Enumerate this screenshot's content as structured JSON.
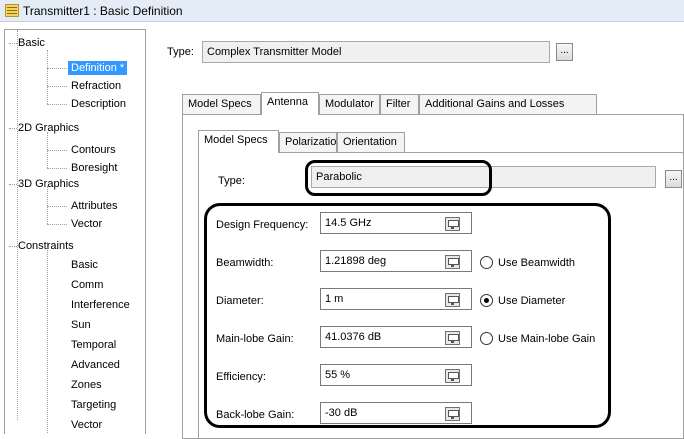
{
  "window": {
    "title": "Transmitter1 : Basic Definition",
    "icon": "document-icon"
  },
  "tree": {
    "items": [
      {
        "label": "Basic",
        "level": 0
      },
      {
        "label": "Definition *",
        "level": 1,
        "selected": true
      },
      {
        "label": "Refraction",
        "level": 1
      },
      {
        "label": "Description",
        "level": 1
      },
      {
        "label": "2D Graphics",
        "level": 0
      },
      {
        "label": "Contours",
        "level": 1
      },
      {
        "label": "Boresight",
        "level": 1
      },
      {
        "label": "3D Graphics",
        "level": 0
      },
      {
        "label": "Attributes",
        "level": 1
      },
      {
        "label": "Vector",
        "level": 1
      },
      {
        "label": "Constraints",
        "level": 0
      },
      {
        "label": "Basic",
        "level": 1
      },
      {
        "label": "Comm",
        "level": 1
      },
      {
        "label": "Interference",
        "level": 1
      },
      {
        "label": "Sun",
        "level": 1
      },
      {
        "label": "Temporal",
        "level": 1
      },
      {
        "label": "Advanced",
        "level": 1
      },
      {
        "label": "Zones",
        "level": 1
      },
      {
        "label": "Targeting",
        "level": 1
      },
      {
        "label": "Vector",
        "level": 1
      }
    ]
  },
  "type_row": {
    "label": "Type:",
    "value": "Complex Transmitter Model",
    "button": "..."
  },
  "outer_tabs": [
    "Model Specs",
    "Antenna",
    "Modulator",
    "Filter",
    "Additional Gains and Losses"
  ],
  "outer_active_tab": "Antenna",
  "inner_tabs": [
    "Model Specs",
    "Polarization",
    "Orientation"
  ],
  "inner_active_tab": "Model Specs",
  "antenna": {
    "type_label": "Type:",
    "type_value": "Parabolic",
    "type_button": "...",
    "fields": [
      {
        "label": "Design Frequency:",
        "value": "14.5 GHz"
      },
      {
        "label": "Beamwidth:",
        "value": "1.21898 deg",
        "radio": "Use Beamwidth",
        "checked": false
      },
      {
        "label": "Diameter:",
        "value": "1 m",
        "radio": "Use Diameter",
        "checked": true
      },
      {
        "label": "Main-lobe Gain:",
        "value": "41.0376 dB",
        "radio": "Use Main-lobe Gain",
        "checked": false
      },
      {
        "label": "Efficiency:",
        "value": "55 %"
      },
      {
        "label": "Back-lobe Gain:",
        "value": "-30 dB"
      }
    ]
  }
}
